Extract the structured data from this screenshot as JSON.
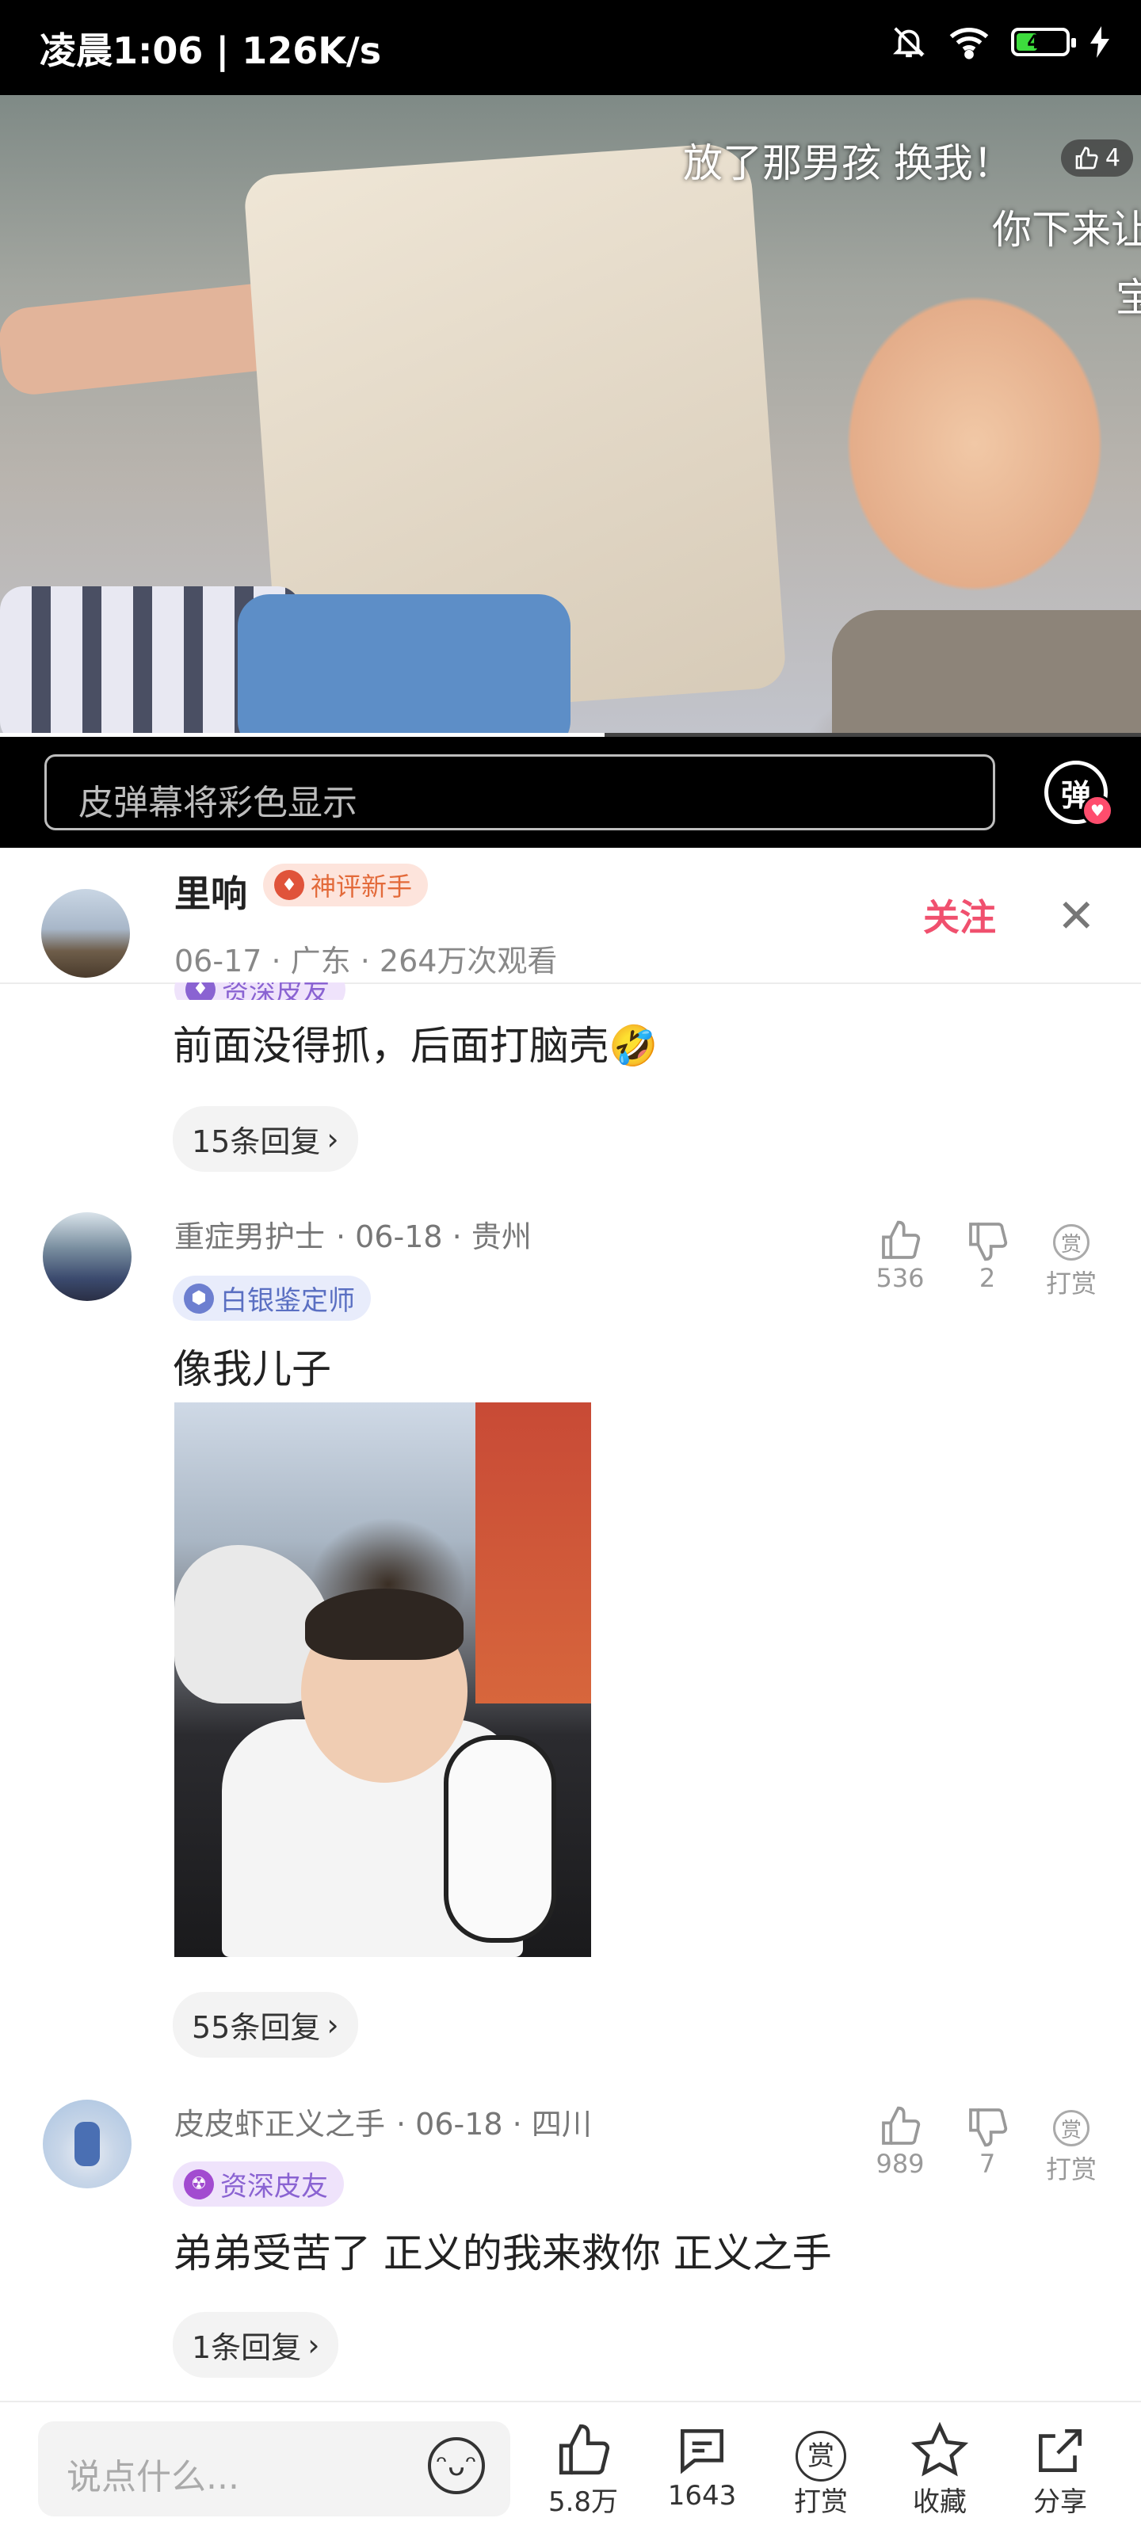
{
  "status_bar": {
    "time": "凌晨1:06 | 126K/s",
    "battery": "47"
  },
  "video": {
    "danmaku": [
      {
        "text": "放了那男孩 换我！"
      },
      {
        "text": "你下来让"
      },
      {
        "text": "宝"
      }
    ],
    "like_count": "4",
    "progress": 0.53
  },
  "danmaku_bar": {
    "placeholder": "皮弹幕将彩色显示",
    "button": "弹"
  },
  "author": {
    "name": "里响",
    "badge": "神评新手",
    "meta": "06-17 · 广东 · 264万次观看",
    "follow": "关注",
    "close": "✕"
  },
  "comments": [
    {
      "partial_badge": "资深皮友",
      "text": "前面没得抓，后面打脑壳🤣",
      "replies": "15条回复"
    },
    {
      "name": "重症男护士",
      "meta": "· 06-18 · 贵州",
      "badge": "白银鉴定师",
      "likes": "536",
      "dislikes": "2",
      "reward": "打赏",
      "text": "像我儿子",
      "replies": "55条回复"
    },
    {
      "name": "皮皮虾正义之手",
      "meta": "· 06-18 · 四川",
      "badge": "资深皮友",
      "likes": "989",
      "dislikes": "7",
      "reward": "打赏",
      "text": "弟弟受苦了 正义的我来救你 正义之手",
      "replies": "1条回复"
    }
  ],
  "bottom_bar": {
    "placeholder": "说点什么...",
    "like": "5.8万",
    "comment": "1643",
    "reward": "打赏",
    "favorite": "收藏",
    "share": "分享"
  },
  "colors": {
    "accent": "#f0506e",
    "badge_orange": "#e36a3a",
    "badge_purple": "#8a63d2"
  }
}
